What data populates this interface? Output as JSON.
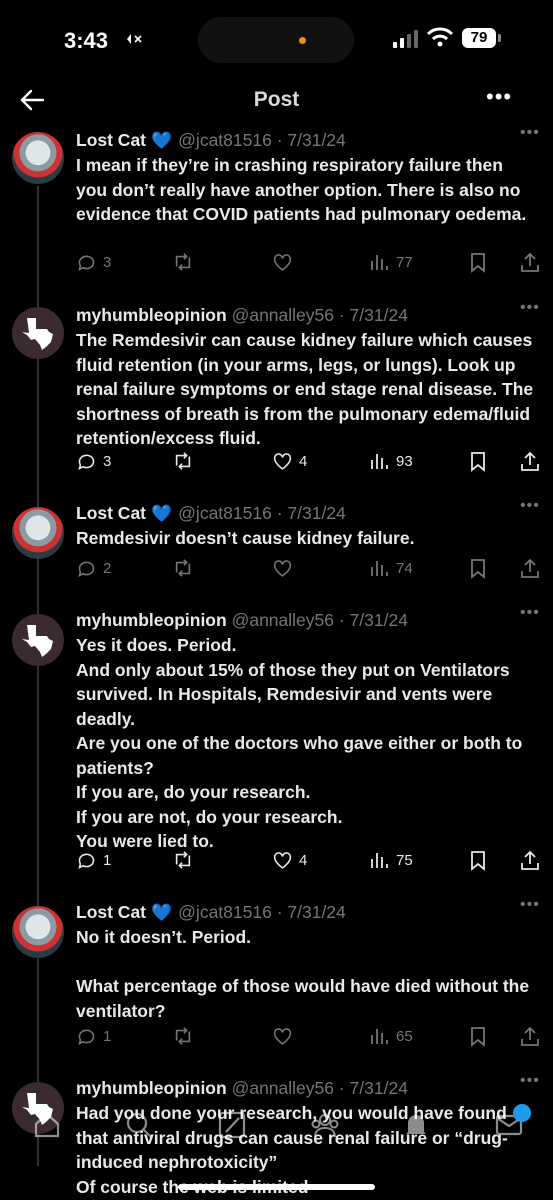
{
  "status_bar": {
    "time": "3:43",
    "battery": "79"
  },
  "header": {
    "title": "Post"
  },
  "tweets": [
    {
      "name": "Lost Cat",
      "handle": "@jcat81516 · 7/31/24",
      "text": "I mean if they’re in crashing respiratory failure then you don’t really have another option. There is also no evidence that COVID patients had pulmonary oedema.",
      "replies": "3",
      "likes": "",
      "views": "77"
    },
    {
      "name": "myhumbleopinion",
      "handle": "@annalley56 · 7/31/24",
      "text": "The Remdesivir can cause kidney failure which causes fluid retention (in your arms, legs, or lungs). Look up renal failure symptoms or end stage renal disease. The shortness of breath is from the pulmonary edema/fluid retention/excess fluid.",
      "replies": "3",
      "likes": "4",
      "views": "93"
    },
    {
      "name": "Lost Cat",
      "handle": "@jcat81516 · 7/31/24",
      "text": "Remdesivir doesn’t cause kidney failure.",
      "replies": "2",
      "likes": "",
      "views": "74"
    },
    {
      "name": "myhumbleopinion",
      "handle": "@annalley56 · 7/31/24",
      "text": "Yes it does. Period.\nAnd only about 15% of those they put on Ventilators survived. In Hospitals, Remdesivir and vents were deadly.\nAre you one of the doctors who gave either or both to patients?\nIf you are, do your research.\nIf you are not, do your research.\nYou were lied to.",
      "replies": "1",
      "likes": "4",
      "views": "75"
    },
    {
      "name": "Lost Cat",
      "handle": "@jcat81516 · 7/31/24",
      "text": "No it doesn’t. Period.\n\nWhat percentage of those would have died without the ventilator?",
      "replies": "1",
      "likes": "",
      "views": "65"
    },
    {
      "name": "myhumbleopinion",
      "handle": "@annalley56 · 7/31/24",
      "text": "Had you done your research, you would have found that antiviral drugs can cause renal failure or “drug-induced nephrotoxicity”\nOf course the web is limited",
      "replies": "",
      "likes": "",
      "views": ""
    }
  ],
  "tab_bar": {
    "notification_badge": ""
  },
  "icons": [
    "back-arrow-icon",
    "more-icon",
    "verified-icon",
    "reply-icon",
    "retweet-icon",
    "like-icon",
    "views-icon",
    "bookmark-icon",
    "share-icon",
    "home-icon",
    "search-icon",
    "grok-icon",
    "communities-icon",
    "notifications-icon",
    "messages-icon"
  ],
  "colors": {
    "accent": "#1d9bf0",
    "muted": "#71767b",
    "text": "#e7e9ea",
    "background": "#000000"
  }
}
